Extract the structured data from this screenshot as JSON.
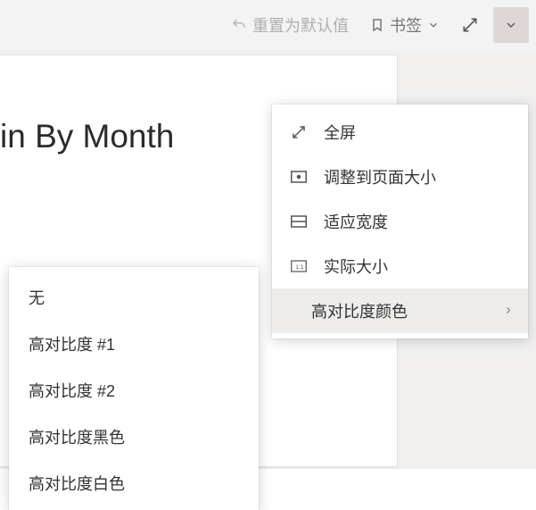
{
  "toolbar": {
    "reset_label": "重置为默认值",
    "bookmark_label": "书签",
    "icons": {
      "undo": "undo-icon",
      "bookmark": "bookmark-icon",
      "chevron_down": "chevron-down-icon",
      "fullscreen": "fullscreen-icon"
    }
  },
  "page": {
    "title_fragment": "in By Month"
  },
  "view_menu": {
    "items": [
      {
        "icon": "fullscreen-icon",
        "label": "全屏"
      },
      {
        "icon": "fit-page-icon",
        "label": "调整到页面大小"
      },
      {
        "icon": "fit-width-icon",
        "label": "适应宽度"
      },
      {
        "icon": "actual-size-icon",
        "label": "实际大小"
      }
    ],
    "submenu_trigger": {
      "label": "高对比度颜色"
    }
  },
  "contrast_submenu": {
    "items": [
      {
        "label": "无"
      },
      {
        "label": "高对比度 #1"
      },
      {
        "label": "高对比度 #2"
      },
      {
        "label": "高对比度黑色"
      },
      {
        "label": "高对比度白色"
      }
    ]
  }
}
